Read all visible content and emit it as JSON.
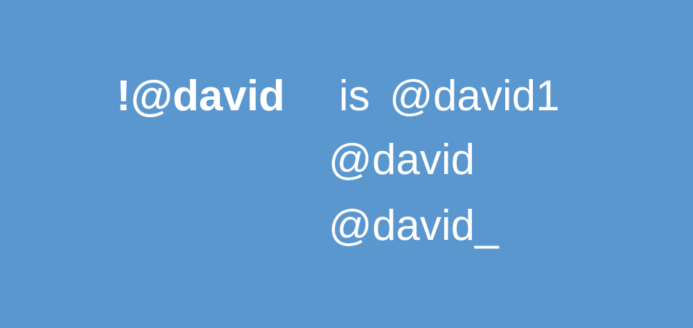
{
  "background_color": "#5b97cf",
  "text_color": "#ffffff",
  "term": "!@david",
  "connector": "is",
  "handles": [
    "@david1",
    "@david",
    "@david_"
  ]
}
